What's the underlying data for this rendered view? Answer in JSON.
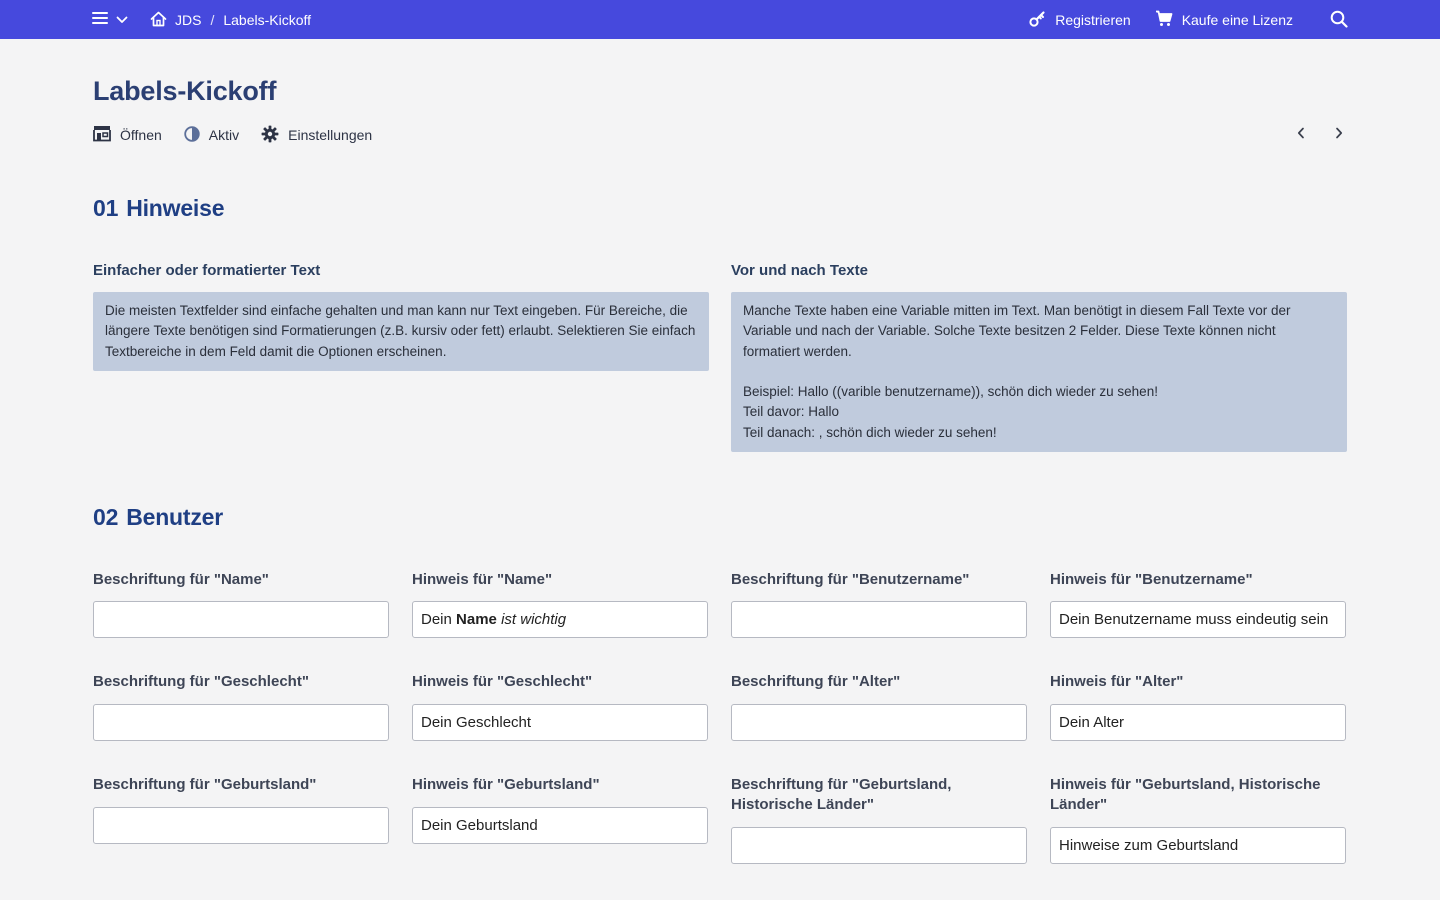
{
  "header": {
    "breadcrumb": [
      "JDS",
      "Labels-Kickoff"
    ],
    "separator": "/",
    "register_label": "Registrieren",
    "license_label": "Kaufe eine Lizenz",
    "bg_color": "#4649dd"
  },
  "page": {
    "title": "Labels-Kickoff",
    "toolbar": {
      "open_label": "Öffnen",
      "active_label": "Aktiv",
      "settings_label": "Einstellungen"
    }
  },
  "sections": [
    {
      "num": "01",
      "title": "Hinweise"
    },
    {
      "num": "02",
      "title": "Benutzer"
    }
  ],
  "notes": [
    {
      "heading": "Einfacher oder formatierter Text",
      "text": "Die meisten Textfelder sind einfache gehalten und man kann nur Text eingeben. Für Bereiche, die längere Texte benötigen sind Formatierungen (z.B. kursiv oder fett) erlaubt. Selektieren Sie einfach Textbereiche in dem Feld damit die Optionen erscheinen."
    },
    {
      "heading": "Vor und nach Texte",
      "text": "Manche Texte haben eine Variable mitten im Text. Man benötigt in diesem Fall Texte vor der Variable und nach der Variable. Solche Texte besitzen 2 Felder. Diese Texte können nicht formatiert werden.\n\nBeispiel: Hallo ((varible benutzername)), schön dich wieder zu sehen!\nTeil davor: Hallo\nTeil danach: , schön dich wieder zu sehen!"
    }
  ],
  "fields": [
    {
      "label": "Beschriftung für \"Name\"",
      "value": ""
    },
    {
      "label": "Hinweis für \"Name\"",
      "value_prefix": "Dein ",
      "value_bold": "Name",
      "value_italic": "ist wichtig"
    },
    {
      "label": "Beschriftung für \"Benutzername\"",
      "value": ""
    },
    {
      "label": "Hinweis für \"Benutzername\"",
      "value": "Dein Benutzername muss eindeutig sein"
    },
    {
      "label": "Beschriftung für \"Geschlecht\"",
      "value": ""
    },
    {
      "label": "Hinweis für \"Geschlecht\"",
      "value": "Dein Geschlecht"
    },
    {
      "label": "Beschriftung für \"Alter\"",
      "value": ""
    },
    {
      "label": "Hinweis für \"Alter\"",
      "value": "Dein Alter"
    },
    {
      "label": "Beschriftung für \"Geburtsland\"",
      "value": ""
    },
    {
      "label": "Hinweis für \"Geburtsland\"",
      "value": "Dein Geburtsland"
    },
    {
      "label_line1": "Beschriftung für \"Geburtsland,",
      "label_line2": "Historische Länder\"",
      "value": ""
    },
    {
      "label_line1": "Hinweis für \"Geburtsland, Historische",
      "label_line2": "Länder\"",
      "value": "Hinweise zum Geburtsland"
    }
  ]
}
